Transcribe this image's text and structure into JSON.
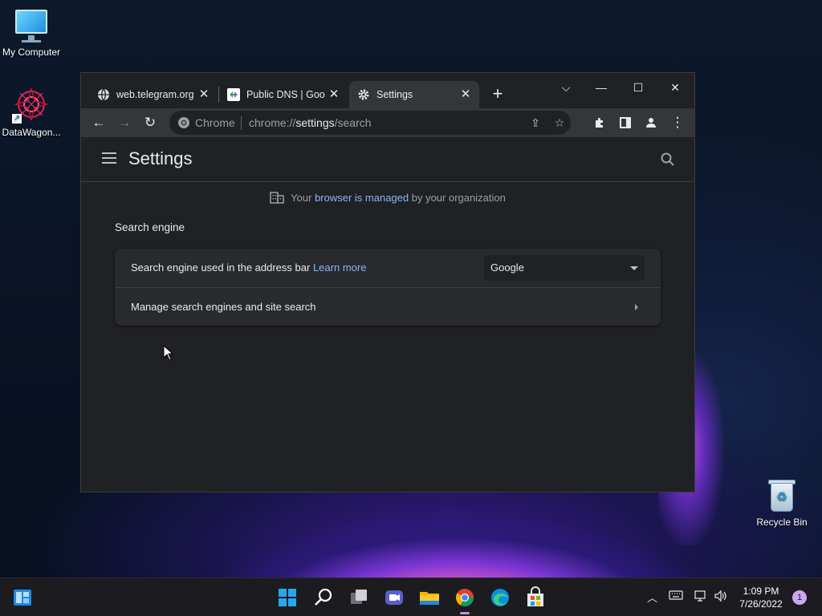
{
  "desktop": {
    "icons": [
      {
        "label": "My Computer"
      },
      {
        "label": "DataWagon..."
      },
      {
        "label": "Recycle Bin"
      }
    ]
  },
  "browser": {
    "tabs": [
      {
        "title": "web.telegram.org",
        "icon": "globe-icon"
      },
      {
        "title": "Public DNS | Goo",
        "icon": "google-dns-icon"
      },
      {
        "title": "Settings",
        "icon": "gear-icon"
      }
    ],
    "active_tab": 2,
    "omnibox": {
      "site_label": "Chrome",
      "url_prefix": "chrome://",
      "url_host": "settings",
      "url_path": "/search"
    },
    "accent": "#8ab4f8"
  },
  "settings": {
    "title": "Settings",
    "managed_notice": {
      "before": "Your ",
      "link": "browser is managed",
      "after": " by your organization"
    },
    "section_title": "Search engine",
    "rows": [
      {
        "label": "Search engine used in the address bar",
        "link": "Learn more",
        "select_value": "Google"
      },
      {
        "label": "Manage search engines and site search"
      }
    ]
  },
  "taskbar": {
    "time": "1:09 PM",
    "date": "7/26/2022",
    "notification_count": "1"
  }
}
